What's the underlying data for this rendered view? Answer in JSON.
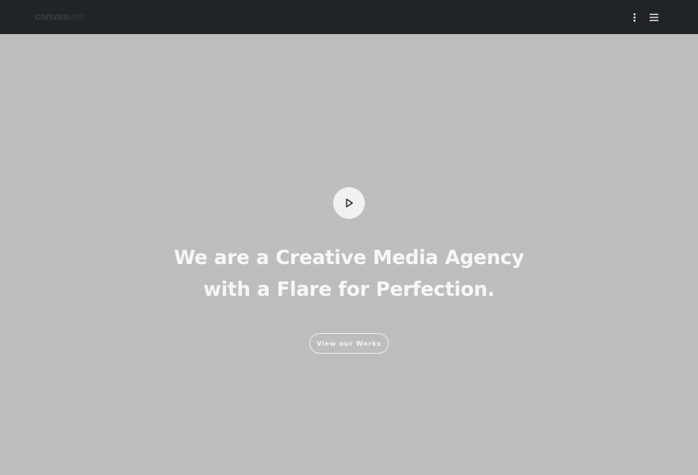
{
  "header": {
    "logo_main": "canvas",
    "logo_sub": "one",
    "kebab_icon": "more-vertical-icon",
    "menu_icon": "hamburger-menu-icon"
  },
  "hero": {
    "play_icon": "play-icon",
    "headline_line1": "We are a Creative Media Agency",
    "headline_line2": "with a Flare for Perfection.",
    "cta_label": "View our Works"
  },
  "colors": {
    "header_bg": "#202328",
    "hero_bg": "#bdbdbd",
    "text": "#f7f7f7"
  }
}
